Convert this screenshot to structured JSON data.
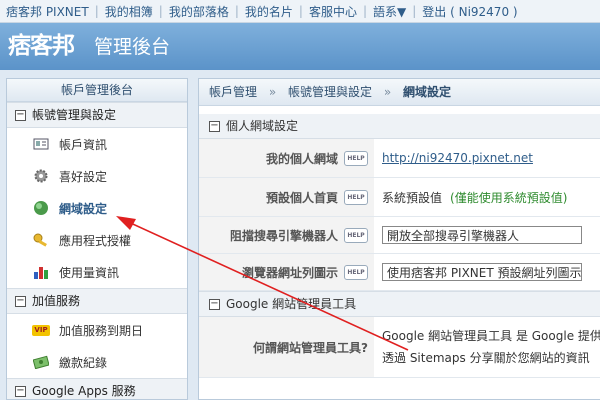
{
  "topnav": {
    "items": [
      "痞客邦 PIXNET",
      "我的相簿",
      "我的部落格",
      "我的名片",
      "客服中心",
      "語系▼",
      "登出 ( Ni92470 )"
    ]
  },
  "header": {
    "logo_text": "痞客邦",
    "title": "管理後台"
  },
  "sidebar": {
    "title": "帳戶管理後台",
    "sections": [
      {
        "toggle": "−",
        "label": "帳號管理與設定",
        "items": [
          {
            "label": "帳戶資訊",
            "icon": "id-card-icon"
          },
          {
            "label": "喜好設定",
            "icon": "gear-icon"
          },
          {
            "label": "網域設定",
            "icon": "globe-icon",
            "active": true
          },
          {
            "label": "應用程式授權",
            "icon": "key-icon"
          },
          {
            "label": "使用量資訊",
            "icon": "bar-chart-icon"
          }
        ]
      },
      {
        "toggle": "−",
        "label": "加值服務",
        "items": [
          {
            "label": "加值服務到期日",
            "icon": "vip-icon",
            "icon_text": "VIP"
          },
          {
            "label": "繳款紀錄",
            "icon": "money-icon"
          }
        ]
      },
      {
        "toggle": "−",
        "label": "Google Apps 服務"
      }
    ]
  },
  "main": {
    "breadcrumb": [
      "帳戶管理",
      "帳號管理與設定",
      "網域設定"
    ],
    "breadcrumb_sep": "»",
    "help_label": "HELP",
    "section1": {
      "toggle": "−",
      "title": "個人網域設定",
      "rows": [
        {
          "label": "我的個人網域",
          "value": "http://ni92470.pixnet.net"
        },
        {
          "label": "預設個人首頁",
          "value": "系統預設值",
          "note": "(僅能使用系統預設值)"
        },
        {
          "label": "阻擋搜尋引擎機器人",
          "value": "開放全部搜尋引擎機器人"
        },
        {
          "label": "瀏覽器網址列圖示",
          "value": "使用痞客邦 PIXNET 預設網址列圖示"
        }
      ]
    },
    "section2": {
      "toggle": "−",
      "title": "Google 網站管理員工具",
      "rows": [
        {
          "label": "何謂網站管理員工具?",
          "line1": "Google 網站管理員工具 是 Google 提供的免費服務",
          "line2": "透過 Sitemaps 分享關於您網站的資訊"
        }
      ]
    }
  },
  "colors": {
    "header_top": "#7fb0dc",
    "header_bottom": "#5b93c9",
    "link": "#2f5d8a",
    "note_green": "#2e8b2e",
    "arrow_red": "#e02020"
  }
}
